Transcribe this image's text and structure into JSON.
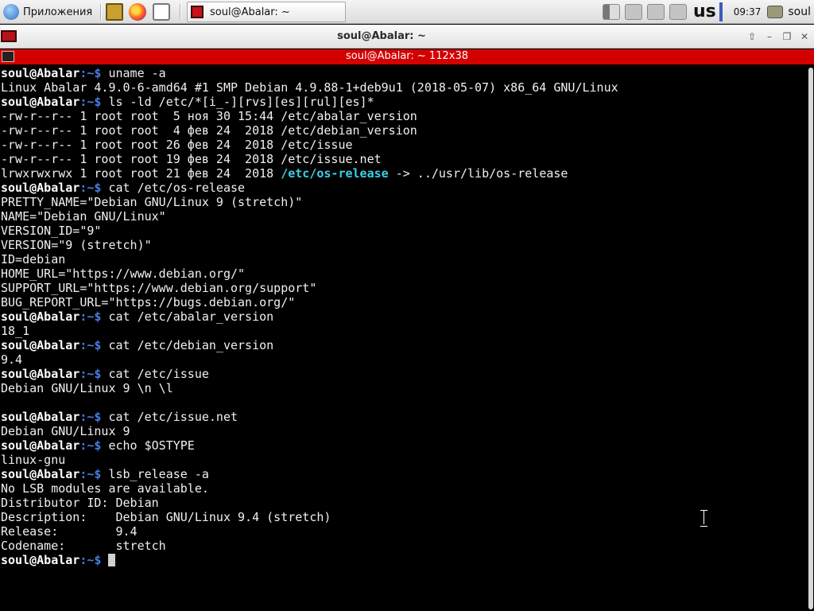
{
  "panel": {
    "apps_label": "Приложения",
    "task_title": "soul@Abalar: ~",
    "keyboard_layout": "us",
    "clock": "09:37",
    "user": "soul"
  },
  "window": {
    "title": "soul@Abalar: ~",
    "terminal_title": "soul@Abalar: ~ 112x38"
  },
  "terminal": {
    "user": "soul@Abalar",
    "path": ":~$",
    "lines": [
      {
        "kind": "prompt",
        "cmd": " uname -a"
      },
      {
        "kind": "out",
        "text": "Linux Abalar 4.9.0-6-amd64 #1 SMP Debian 4.9.88-1+deb9u1 (2018-05-07) x86_64 GNU/Linux"
      },
      {
        "kind": "prompt",
        "cmd": " ls -ld /etc/*[i_-][rvs][es][rul][es]*"
      },
      {
        "kind": "out",
        "text": "-rw-r--r-- 1 root root  5 ноя 30 15:44 /etc/abalar_version"
      },
      {
        "kind": "out",
        "text": "-rw-r--r-- 1 root root  4 фев 24  2018 /etc/debian_version"
      },
      {
        "kind": "out",
        "text": "-rw-r--r-- 1 root root 26 фев 24  2018 /etc/issue"
      },
      {
        "kind": "out",
        "text": "-rw-r--r-- 1 root root 19 фев 24  2018 /etc/issue.net"
      },
      {
        "kind": "link",
        "pre": "lrwxrwxrwx 1 root root 21 фев 24  2018 ",
        "name": "/etc/os-release",
        "post": " -> ../usr/lib/os-release"
      },
      {
        "kind": "prompt",
        "cmd": " cat /etc/os-release"
      },
      {
        "kind": "out",
        "text": "PRETTY_NAME=\"Debian GNU/Linux 9 (stretch)\""
      },
      {
        "kind": "out",
        "text": "NAME=\"Debian GNU/Linux\""
      },
      {
        "kind": "out",
        "text": "VERSION_ID=\"9\""
      },
      {
        "kind": "out",
        "text": "VERSION=\"9 (stretch)\""
      },
      {
        "kind": "out",
        "text": "ID=debian"
      },
      {
        "kind": "out",
        "text": "HOME_URL=\"https://www.debian.org/\""
      },
      {
        "kind": "out",
        "text": "SUPPORT_URL=\"https://www.debian.org/support\""
      },
      {
        "kind": "out",
        "text": "BUG_REPORT_URL=\"https://bugs.debian.org/\""
      },
      {
        "kind": "prompt",
        "cmd": " cat /etc/abalar_version"
      },
      {
        "kind": "out",
        "text": "18_1"
      },
      {
        "kind": "prompt",
        "cmd": " cat /etc/debian_version"
      },
      {
        "kind": "out",
        "text": "9.4"
      },
      {
        "kind": "prompt",
        "cmd": " cat /etc/issue"
      },
      {
        "kind": "out",
        "text": "Debian GNU/Linux 9 \\n \\l"
      },
      {
        "kind": "out",
        "text": ""
      },
      {
        "kind": "prompt",
        "cmd": " cat /etc/issue.net"
      },
      {
        "kind": "out",
        "text": "Debian GNU/Linux 9"
      },
      {
        "kind": "prompt",
        "cmd": " echo $OSTYPE"
      },
      {
        "kind": "out",
        "text": "linux-gnu"
      },
      {
        "kind": "prompt",
        "cmd": " lsb_release -a"
      },
      {
        "kind": "out",
        "text": "No LSB modules are available."
      },
      {
        "kind": "out",
        "text": "Distributor ID:\tDebian"
      },
      {
        "kind": "out",
        "text": "Description:\tDebian GNU/Linux 9.4 (stretch)"
      },
      {
        "kind": "out",
        "text": "Release:\t9.4"
      },
      {
        "kind": "out",
        "text": "Codename:\tstretch"
      },
      {
        "kind": "cursor",
        "cmd": " "
      }
    ]
  },
  "colors": {
    "terminal_bg": "#000000",
    "terminal_fg": "#f0f0f0",
    "prompt_path": "#4a7ce0",
    "symlink": "#3ad0e8",
    "terminal_titlebar": "#d30000"
  },
  "icons": {
    "apps": "applications-menu-icon",
    "files": "file-manager-icon",
    "browser": "firefox-icon",
    "chat": "chat-icon",
    "terminal": "terminal-icon"
  }
}
